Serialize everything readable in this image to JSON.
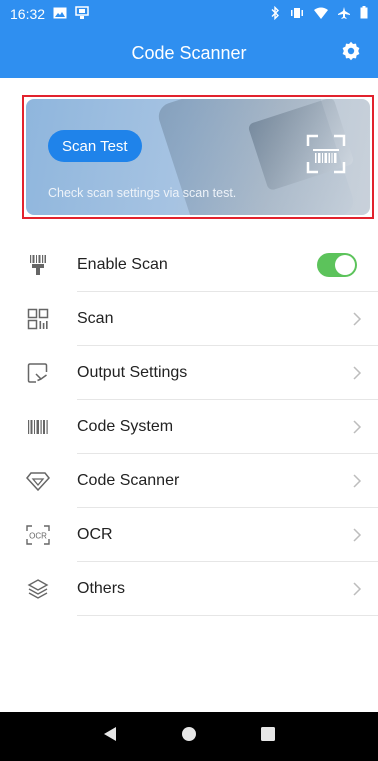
{
  "status_bar": {
    "time": "16:32",
    "left_icons": [
      "image-icon",
      "screen-share-icon"
    ],
    "right_icons": [
      "bluetooth-icon",
      "vibrate-icon",
      "wifi-icon",
      "airplane-mode-icon",
      "battery-icon"
    ]
  },
  "app_bar": {
    "title": "Code Scanner",
    "settings_icon": "gear-icon"
  },
  "banner": {
    "button_label": "Scan Test",
    "description": "Check scan settings via scan test.",
    "icon": "barcode-scan-icon"
  },
  "menu": {
    "items": [
      {
        "label": "Enable Scan",
        "icon": "scanner-gun-icon",
        "toggle_on": true
      },
      {
        "label": "Scan",
        "icon": "qr-grid-icon"
      },
      {
        "label": "Output Settings",
        "icon": "output-arrow-icon"
      },
      {
        "label": "Code System",
        "icon": "barcode-icon"
      },
      {
        "label": "Code Scanner",
        "icon": "diamond-icon"
      },
      {
        "label": "OCR",
        "icon": "ocr-icon",
        "icon_text": "OCR"
      },
      {
        "label": "Others",
        "icon": "layers-icon"
      }
    ]
  },
  "nav_bar": {
    "buttons": [
      "back-icon",
      "home-icon",
      "recents-icon"
    ]
  },
  "colors": {
    "primary": "#2f8ff0",
    "toggle_on": "#5cc35b",
    "highlight_border": "#e2222d"
  }
}
